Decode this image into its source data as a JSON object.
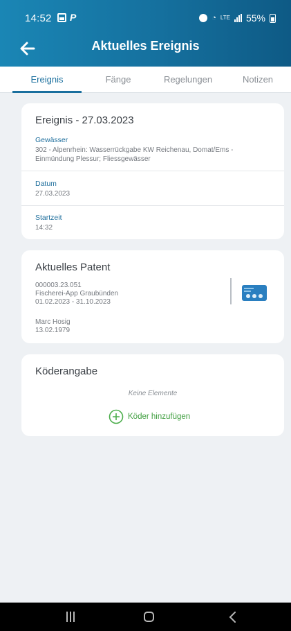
{
  "status_bar": {
    "time": "14:52",
    "battery": "55%",
    "network_lte": "LTE"
  },
  "app_bar": {
    "title": "Aktuelles Ereignis",
    "back_icon": "arrow-left-icon"
  },
  "tabs": [
    {
      "label": "Ereignis",
      "active": true
    },
    {
      "label": "Fänge",
      "active": false
    },
    {
      "label": "Regelungen",
      "active": false
    },
    {
      "label": "Notizen",
      "active": false
    }
  ],
  "event_card": {
    "title": "Ereignis - 27.03.2023",
    "water_label": "Gewässer",
    "water_line1": "302 - Alpenrhein: Wasserrückgabe KW Reichenau, Domat/Ems -",
    "water_line2": "Einmündung Plessur; Fliessgewässer",
    "date_label": "Datum",
    "date_value": "27.03.2023",
    "start_label": "Startzeit",
    "start_value": "14:32"
  },
  "patent_card": {
    "title": "Aktuelles Patent",
    "number": "000003.23.051",
    "app_name": "Fischerei-App Graubünden",
    "validity": "01.02.2023 - 31.10.2023",
    "holder_name": "Marc Hosig",
    "holder_birthdate": "13.02.1979",
    "card_icon": "patent-card-icon"
  },
  "bait_card": {
    "title": "Köderangabe",
    "empty_text": "Keine Elemente",
    "add_button_label": "Köder hinzufügen",
    "add_icon": "plus-circle-icon"
  },
  "colors": {
    "header_start": "#1a86b5",
    "header_end": "#0e5a85",
    "accent_blue": "#1a6f9e",
    "add_green": "#4cae4c",
    "background": "#eef1f4"
  }
}
